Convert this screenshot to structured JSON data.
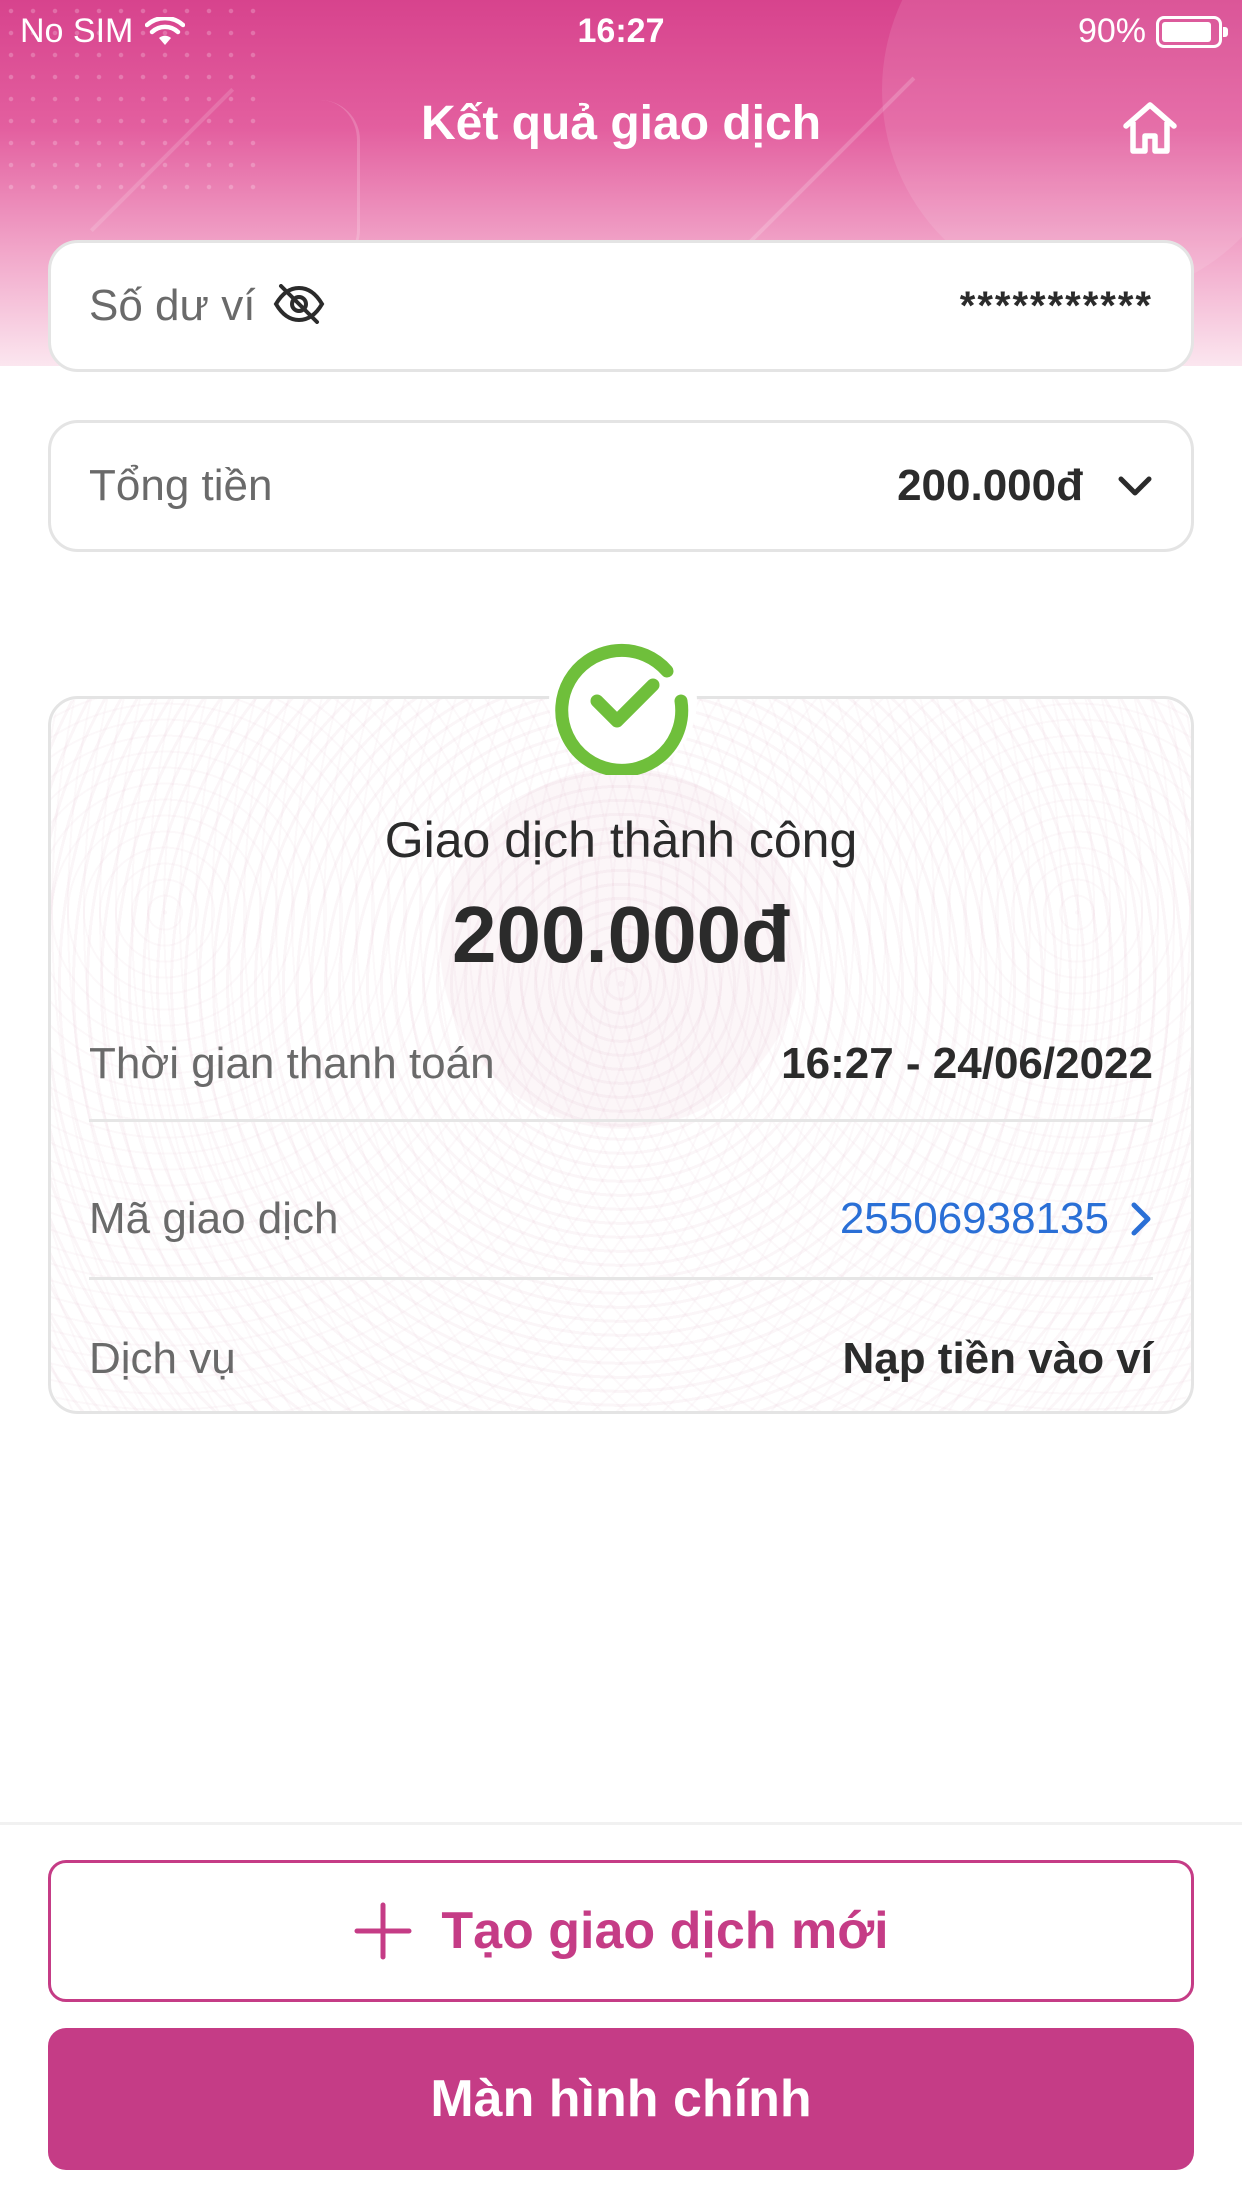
{
  "status_bar": {
    "carrier": "No SIM",
    "time": "16:27",
    "battery_percent": "90%",
    "battery_level": 0.9
  },
  "header": {
    "title": "Kết quả giao dịch",
    "home_icon": "home-icon"
  },
  "balance": {
    "label": "Số dư ví",
    "visibility_icon": "eye-off-icon",
    "value": "***********"
  },
  "total": {
    "label": "Tổng tiền",
    "value": "200.000đ",
    "toggle_icon": "chevron-down-icon"
  },
  "result": {
    "status_icon": "check-circle-icon",
    "status_text": "Giao dịch thành công",
    "amount": "200.000đ",
    "rows": [
      {
        "label": "Thời gian thanh toán",
        "value": "16:27 - 24/06/2022"
      },
      {
        "label": "Mã giao dịch",
        "value": "25506938135"
      },
      {
        "label": "Dịch vụ",
        "value": "Nạp tiền vào ví"
      }
    ]
  },
  "actions": {
    "new_transaction": "Tạo giao dịch mới",
    "main_screen": "Màn hình chính"
  },
  "colors": {
    "brand": "#c53c86",
    "success": "#6fbf3b",
    "link": "#2a6fd6"
  }
}
